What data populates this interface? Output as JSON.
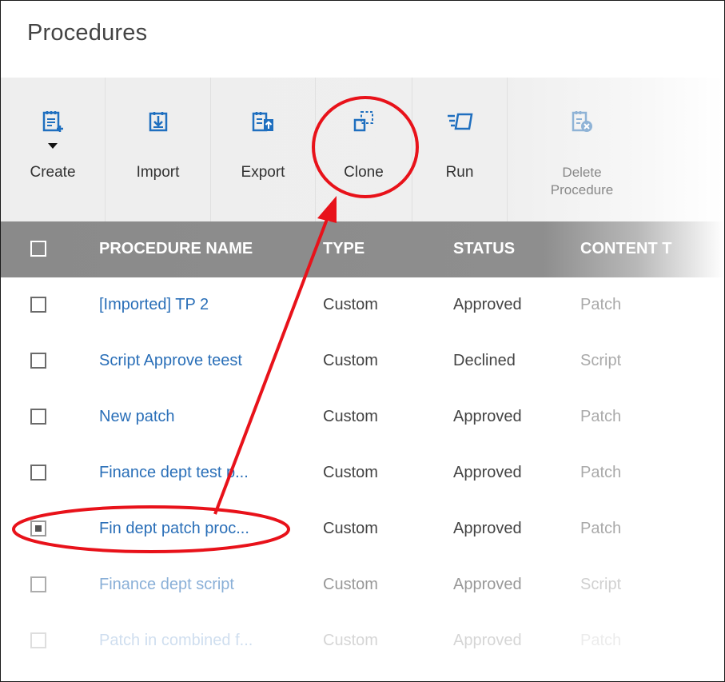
{
  "page": {
    "title": "Procedures"
  },
  "toolbar": {
    "create": "Create",
    "import": "Import",
    "export": "Export",
    "clone": "Clone",
    "run": "Run",
    "delete": "Delete Procedure"
  },
  "table": {
    "headers": {
      "name": "PROCEDURE NAME",
      "type": "TYPE",
      "status": "STATUS",
      "content": "CONTENT T"
    },
    "rows": [
      {
        "name": "[Imported] TP 2",
        "type": "Custom",
        "status": "Approved",
        "content": "Patch",
        "checked": false
      },
      {
        "name": "Script Approve teest",
        "type": "Custom",
        "status": "Declined",
        "content": "Script",
        "checked": false
      },
      {
        "name": "New patch",
        "type": "Custom",
        "status": "Approved",
        "content": "Patch",
        "checked": false
      },
      {
        "name": "Finance dept test p...",
        "type": "Custom",
        "status": "Approved",
        "content": "Patch",
        "checked": false
      },
      {
        "name": "Fin dept patch proc...",
        "type": "Custom",
        "status": "Approved",
        "content": "Patch",
        "checked": true
      },
      {
        "name": "Finance dept script",
        "type": "Custom",
        "status": "Approved",
        "content": "Script",
        "checked": false
      },
      {
        "name": "Patch in combined f...",
        "type": "Custom",
        "status": "Approved",
        "content": "Patch",
        "checked": false
      }
    ]
  },
  "annotation_color": "#e8121a",
  "link_color": "#2a6fb8",
  "header_color": "#8a8a8a"
}
